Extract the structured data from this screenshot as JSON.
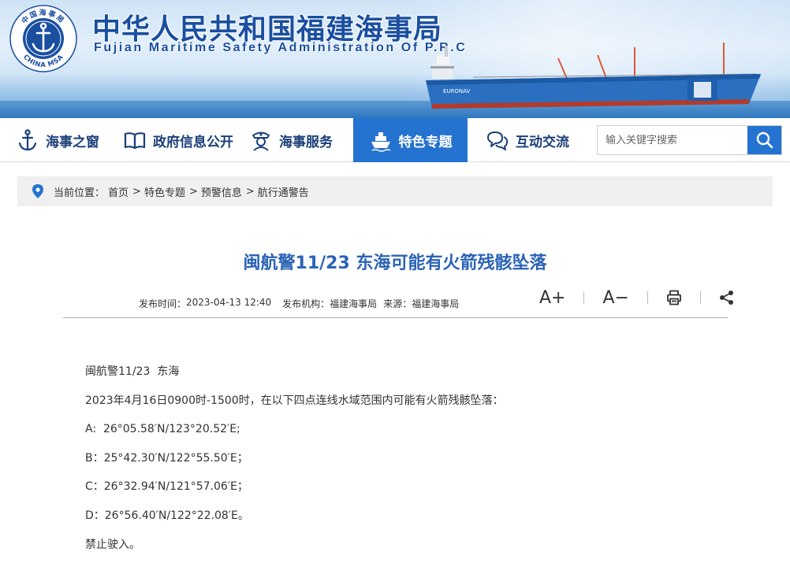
{
  "header": {
    "title_cn": "中华人民共和国福建海事局",
    "title_en": "Fujian  Maritime  Safety  Administration  Of  P.R.C",
    "logo_text_top": "中国海事局",
    "logo_text_bottom": "CHINA MSA",
    "ship_label": "EURONAV"
  },
  "nav": {
    "items": [
      {
        "label": "海事之窗",
        "icon": "anchor-icon"
      },
      {
        "label": "政府信息公开",
        "icon": "book-icon"
      },
      {
        "label": "海事服务",
        "icon": "officer-badge-icon"
      },
      {
        "label": "特色专题",
        "icon": "ship-icon",
        "active": true
      },
      {
        "label": "互动交流",
        "icon": "chat-bubbles-icon"
      }
    ],
    "search_placeholder": "输入关键字搜索"
  },
  "breadcrumb": {
    "label": "当前位置：",
    "items": [
      "首页",
      "特色专题",
      "预警信息",
      "航行通警告"
    ]
  },
  "article": {
    "title": "闽航警11/23 东海可能有火箭残骸坠落",
    "publish_time_label": "发布时间：",
    "publish_time": "2023-04-13 12:40",
    "publisher_label": "发布机构：",
    "publisher": "福建海事局",
    "source_label": "来源：",
    "source": "福建海事局",
    "tools": {
      "font_increase": "A+",
      "font_decrease": "A−"
    },
    "paragraphs": [
      "闽航警11/23  东海",
      "2023年4月16日0900时-1500时，在以下四点连线水域范围内可能有火箭残骸坠落：",
      "A:  26°05.58′N/123°20.52′E;",
      "B：25°42.30′N/122°55.50′E；",
      "C：26°32.94′N/121°57.06′E；",
      "D：26°56.40′N/122°22.08′E。",
      "禁止驶入。"
    ]
  },
  "colors": {
    "brand_blue": "#2573d0",
    "title_blue": "#2b63b5",
    "nav_text": "#1b3f78"
  }
}
